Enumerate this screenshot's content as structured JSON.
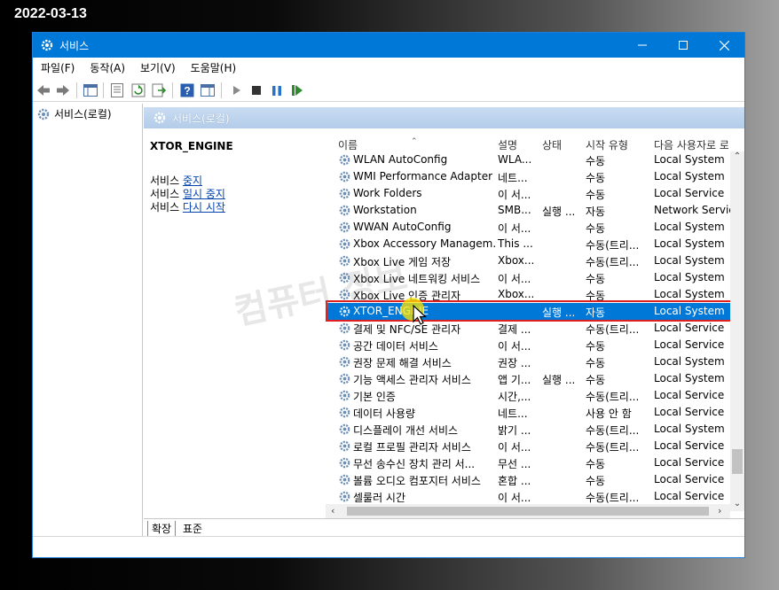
{
  "date_stamp": "2022-03-13",
  "window": {
    "title": "서비스"
  },
  "menu": [
    "파일(F)",
    "동작(A)",
    "보기(V)",
    "도움말(H)"
  ],
  "tree": {
    "root_label": "서비스(로컬)"
  },
  "pane": {
    "title": "서비스(로컬)"
  },
  "selected_service": {
    "name": "XTOR_ENGINE",
    "actions": [
      {
        "prefix": "서비스 ",
        "link": "중지"
      },
      {
        "prefix": "서비스 ",
        "link": "일시 중지"
      },
      {
        "prefix": "서비스 ",
        "link": "다시 시작"
      }
    ]
  },
  "columns": {
    "name": "이름",
    "description": "설명",
    "status": "상태",
    "startup": "시작 유형",
    "logon": "다음 사용자로 로"
  },
  "services": [
    {
      "name": "WLAN AutoConfig",
      "desc": "WLA...",
      "status": "",
      "startup": "수동",
      "logon": "Local System"
    },
    {
      "name": "WMI Performance Adapter",
      "desc": "네트...",
      "status": "",
      "startup": "수동",
      "logon": "Local System"
    },
    {
      "name": "Work Folders",
      "desc": "이 서...",
      "status": "",
      "startup": "수동",
      "logon": "Local Service"
    },
    {
      "name": "Workstation",
      "desc": "SMB...",
      "status": "실행 ...",
      "startup": "자동",
      "logon": "Network Service"
    },
    {
      "name": "WWAN AutoConfig",
      "desc": "이 서...",
      "status": "",
      "startup": "수동",
      "logon": "Local System"
    },
    {
      "name": "Xbox Accessory Managem...",
      "desc": "This ...",
      "status": "",
      "startup": "수동(트리...",
      "logon": "Local System"
    },
    {
      "name": "Xbox Live 게임 저장",
      "desc": "Xbox...",
      "status": "",
      "startup": "수동(트리...",
      "logon": "Local System"
    },
    {
      "name": "Xbox Live 네트워킹 서비스",
      "desc": "이 서...",
      "status": "",
      "startup": "수동",
      "logon": "Local System"
    },
    {
      "name": "Xbox Live 인증 관리자",
      "desc": "Xbox...",
      "status": "",
      "startup": "수동",
      "logon": "Local System"
    },
    {
      "name": "XTOR_ENGINE",
      "desc": "",
      "status": "실행 ...",
      "startup": "자동",
      "logon": "Local System",
      "selected": true
    },
    {
      "name": "결제 및 NFC/SE 관리자",
      "desc": "결제 ...",
      "status": "",
      "startup": "수동(트리...",
      "logon": "Local Service"
    },
    {
      "name": "공간 데이터 서비스",
      "desc": "이 서...",
      "status": "",
      "startup": "수동",
      "logon": "Local Service"
    },
    {
      "name": "권장 문제 해결 서비스",
      "desc": "권장 ...",
      "status": "",
      "startup": "수동",
      "logon": "Local System"
    },
    {
      "name": "기능 액세스 관리자 서비스",
      "desc": "앱 기...",
      "status": "실행 ...",
      "startup": "수동",
      "logon": "Local System"
    },
    {
      "name": "기본 인증",
      "desc": "시간,...",
      "status": "",
      "startup": "수동(트리...",
      "logon": "Local Service"
    },
    {
      "name": "데이터 사용량",
      "desc": "네트...",
      "status": "",
      "startup": "사용 안 함",
      "logon": "Local Service"
    },
    {
      "name": "디스플레이 개선 서비스",
      "desc": "밝기 ...",
      "status": "",
      "startup": "수동(트리...",
      "logon": "Local System"
    },
    {
      "name": "로컬 프로필 관리자 서비스",
      "desc": "이 서...",
      "status": "",
      "startup": "수동(트리...",
      "logon": "Local Service"
    },
    {
      "name": "무선 송수신 장치 관리 서...",
      "desc": "무선 ...",
      "status": "",
      "startup": "수동",
      "logon": "Local Service"
    },
    {
      "name": "볼륨 오디오 컴포지터 서비스",
      "desc": "혼합 ...",
      "status": "",
      "startup": "수동",
      "logon": "Local Service"
    },
    {
      "name": "셀룰러 시간",
      "desc": "이 서...",
      "status": "",
      "startup": "수동(트리...",
      "logon": "Local Service"
    }
  ],
  "tabs": [
    "확장",
    "표준"
  ],
  "watermark": "컴퓨터 정보",
  "colors": {
    "accent": "#0078d7",
    "highlight_frame": "#e02020"
  }
}
